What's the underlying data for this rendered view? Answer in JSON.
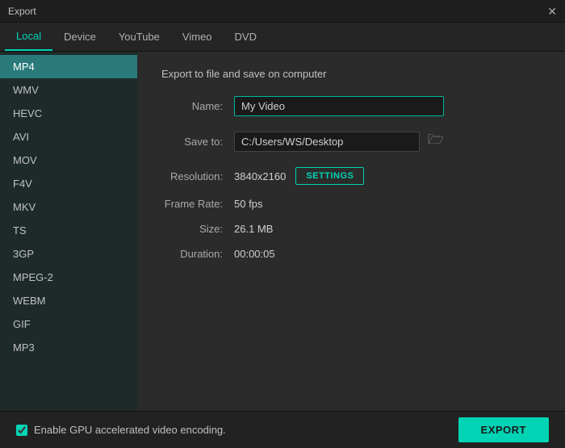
{
  "titleBar": {
    "title": "Export",
    "closeLabel": "✕"
  },
  "tabs": [
    {
      "id": "local",
      "label": "Local",
      "active": true
    },
    {
      "id": "device",
      "label": "Device",
      "active": false
    },
    {
      "id": "youtube",
      "label": "YouTube",
      "active": false
    },
    {
      "id": "vimeo",
      "label": "Vimeo",
      "active": false
    },
    {
      "id": "dvd",
      "label": "DVD",
      "active": false
    }
  ],
  "sidebar": {
    "items": [
      {
        "id": "mp4",
        "label": "MP4",
        "active": true
      },
      {
        "id": "wmv",
        "label": "WMV",
        "active": false
      },
      {
        "id": "hevc",
        "label": "HEVC",
        "active": false
      },
      {
        "id": "avi",
        "label": "AVI",
        "active": false
      },
      {
        "id": "mov",
        "label": "MOV",
        "active": false
      },
      {
        "id": "f4v",
        "label": "F4V",
        "active": false
      },
      {
        "id": "mkv",
        "label": "MKV",
        "active": false
      },
      {
        "id": "ts",
        "label": "TS",
        "active": false
      },
      {
        "id": "3gp",
        "label": "3GP",
        "active": false
      },
      {
        "id": "mpeg2",
        "label": "MPEG-2",
        "active": false
      },
      {
        "id": "webm",
        "label": "WEBM",
        "active": false
      },
      {
        "id": "gif",
        "label": "GIF",
        "active": false
      },
      {
        "id": "mp3",
        "label": "MP3",
        "active": false
      }
    ]
  },
  "mainPanel": {
    "panelTitle": "Export to file and save on computer",
    "fields": {
      "namePlaceholder": "My Video",
      "nameValue": "My Video",
      "nameLabel": "Name:",
      "saveToLabel": "Save to:",
      "savePath": "C:/Users/WS/Desktop",
      "resolutionLabel": "Resolution:",
      "resolutionValue": "3840x2160",
      "settingsLabel": "SETTINGS",
      "frameRateLabel": "Frame Rate:",
      "frameRateValue": "50 fps",
      "sizeLabel": "Size:",
      "sizeValue": "26.1 MB",
      "durationLabel": "Duration:",
      "durationValue": "00:00:05"
    }
  },
  "footer": {
    "gpuLabel": "Enable GPU accelerated video encoding.",
    "exportLabel": "EXPORT"
  }
}
